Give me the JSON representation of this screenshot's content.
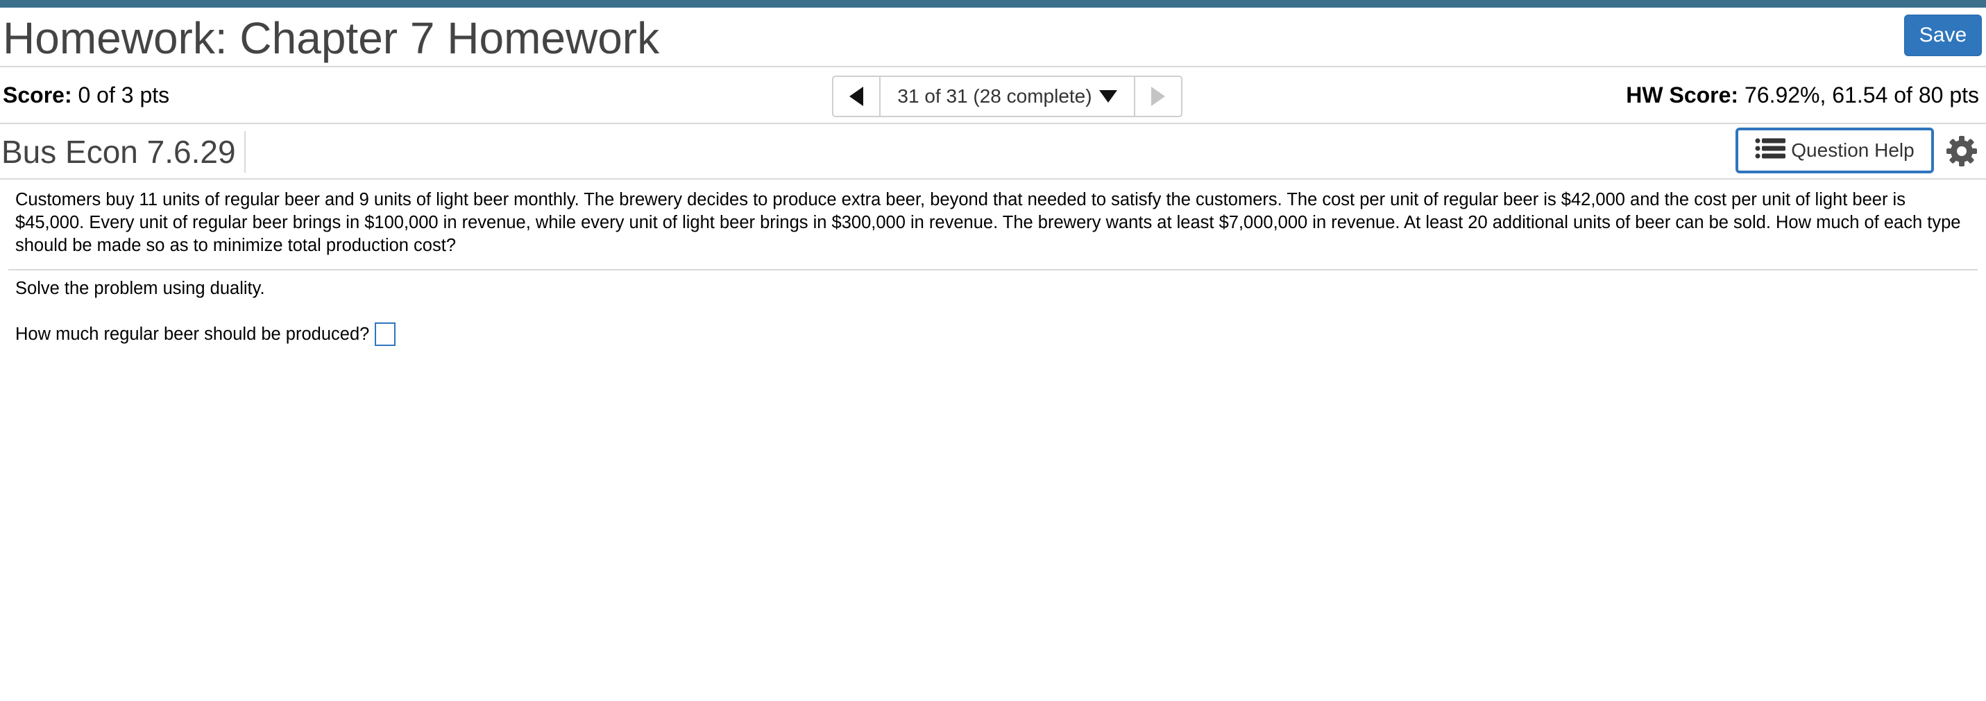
{
  "header": {
    "title": "Homework: Chapter 7 Homework",
    "save_label": "Save"
  },
  "score_bar": {
    "score_label": "Score:",
    "score_value": "0 of 3 pts",
    "pager_text": "31 of 31 (28 complete)",
    "hw_score_label": "HW Score:",
    "hw_score_value": "76.92%, 61.54 of 80 pts"
  },
  "question_bar": {
    "question_id": "Bus Econ 7.6.29",
    "help_label": "Question Help"
  },
  "question": {
    "text": "Customers buy 11 units of regular beer and 9 units of light beer monthly. The brewery decides to produce extra beer, beyond that needed to satisfy the customers. The cost per unit of regular beer is $42,000 and the cost per unit of light beer is $45,000. Every unit of regular beer brings in $100,000 in revenue, while every unit of light beer brings in $300,000 in revenue. The brewery wants at least $7,000,000 in revenue. At least 20 additional units of beer can be sold. How much of each type should be made so as to minimize total production cost?",
    "instruction": "Solve the problem using duality.",
    "prompt": "How much regular beer should be produced?",
    "answer_value": ""
  },
  "colors": {
    "top_rule": "#3b6f8c",
    "primary_blue": "#2f76bd",
    "title_text": "#444444",
    "divider": "#d9d9d9"
  },
  "icons": {
    "prev": "caret-left-icon",
    "next": "caret-right-icon",
    "dropdown": "caret-down-icon",
    "help": "list-icon",
    "settings": "gear-icon"
  }
}
